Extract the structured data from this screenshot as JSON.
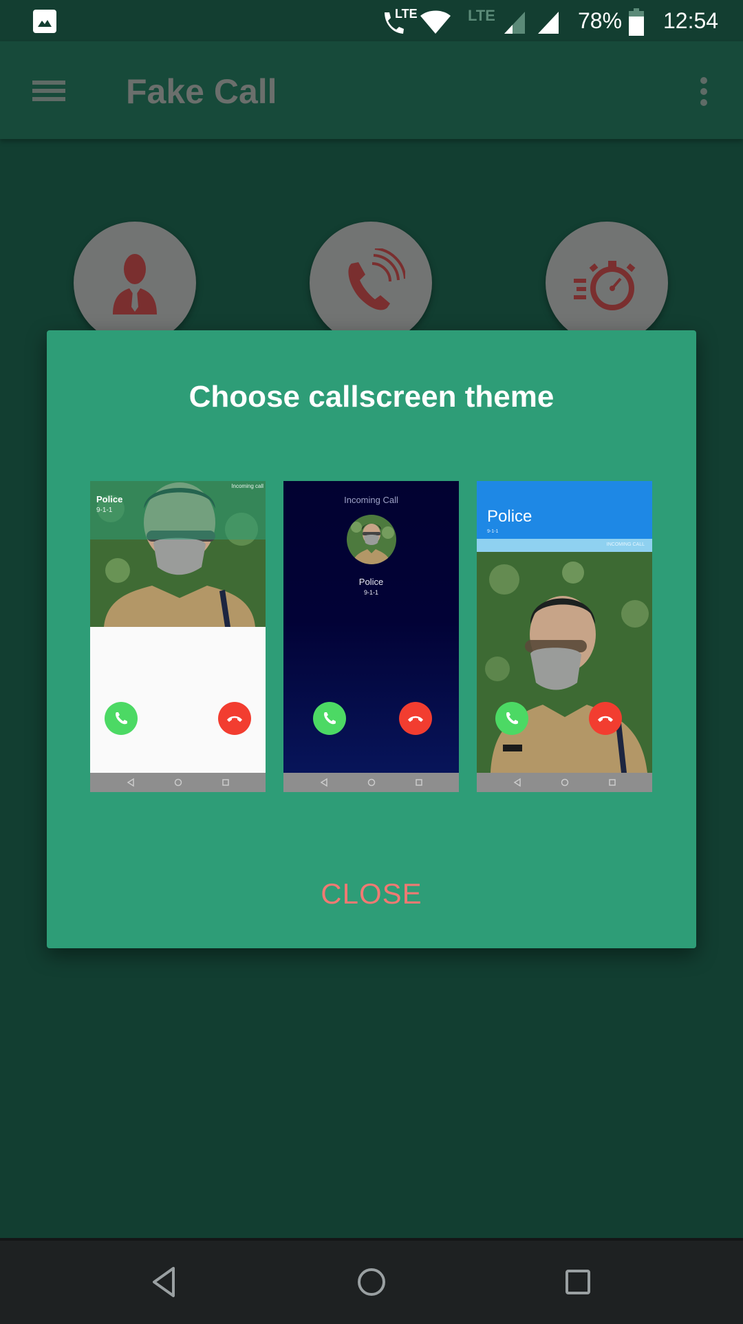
{
  "status_bar": {
    "notification_icon": "image-icon",
    "call_lte_label": "LTE",
    "data_lte_label": "LTE",
    "battery_percent": "78%",
    "battery_level": 0.78,
    "time": "12:54"
  },
  "toolbar": {
    "menu_icon": "hamburger-menu-icon",
    "title": "Fake Call",
    "overflow_icon": "more-vert-icon"
  },
  "feature_buttons": [
    {
      "name": "caller-profile",
      "icon": "person-icon"
    },
    {
      "name": "call-settings",
      "icon": "phone-ringing-icon"
    },
    {
      "name": "timer",
      "icon": "stopwatch-icon"
    }
  ],
  "dialog": {
    "title": "Choose callscreen theme",
    "close_label": "CLOSE",
    "themes": [
      {
        "style": "photo-top-white-bottom",
        "caller_name": "Police",
        "caller_number": "9-1-1",
        "status_label": "Incoming call"
      },
      {
        "style": "dark-navy-avatar",
        "status_label": "Incoming Call",
        "caller_name": "Police",
        "caller_number": "9-1-1"
      },
      {
        "style": "blue-header-fullphoto",
        "caller_name": "Police",
        "caller_number": "9-1-1",
        "status_label": "INCOMING CALL"
      }
    ]
  },
  "colors": {
    "background": "#123e31",
    "toolbar": "#174a3a",
    "dialog": "#2e9d77",
    "close_text": "#f07a73",
    "accept": "#4cd964",
    "decline": "#f23d30",
    "navy": "#020236",
    "blue_header": "#1e88e5",
    "light_blue_strip": "#8fd1f0",
    "icon_red": "#7a2f2f"
  },
  "system_nav": {
    "back_icon": "back-triangle-icon",
    "home_icon": "home-circle-icon",
    "recents_icon": "recents-square-icon"
  }
}
